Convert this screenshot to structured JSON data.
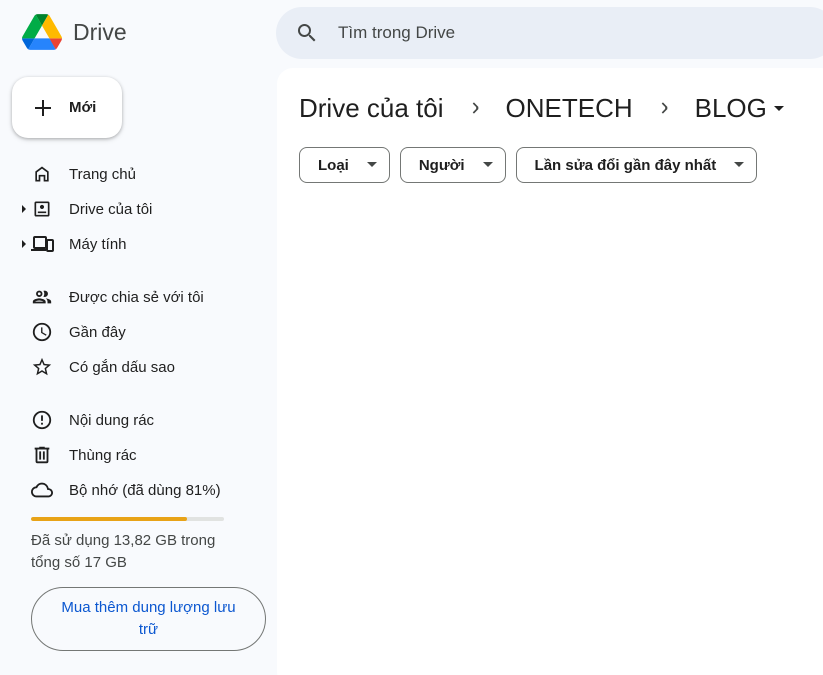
{
  "app": {
    "name": "Drive"
  },
  "search": {
    "placeholder": "Tìm trong Drive"
  },
  "new_button": {
    "label": "Mới"
  },
  "sidebar": {
    "items": [
      {
        "label": "Trang chủ",
        "icon": "home-icon"
      },
      {
        "label": "Drive của tôi",
        "icon": "my-drive-icon",
        "expandable": true
      },
      {
        "label": "Máy tính",
        "icon": "computers-icon",
        "expandable": true
      },
      {
        "label": "Được chia sẻ với tôi",
        "icon": "shared-icon"
      },
      {
        "label": "Gần đây",
        "icon": "clock-icon"
      },
      {
        "label": "Có gắn dấu sao",
        "icon": "star-icon"
      },
      {
        "label": "Nội dung rác",
        "icon": "spam-icon"
      },
      {
        "label": "Thùng rác",
        "icon": "trash-icon"
      },
      {
        "label": "Bộ nhớ (đã dùng 81%)",
        "icon": "cloud-icon"
      }
    ]
  },
  "storage": {
    "used_fraction": 0.81,
    "text": "Đã sử dụng 13,82 GB trong tổng số 17 GB",
    "buy_label": "Mua thêm dung lượng lưu trữ"
  },
  "breadcrumb": {
    "items": [
      "Drive của tôi",
      "ONETECH"
    ],
    "current": "BLOG"
  },
  "filters": {
    "type_label": "Loại",
    "people_label": "Người",
    "modified_label": "Lần sửa đổi gần đây nhất"
  },
  "colors": {
    "background": "#f8fafd",
    "search_bg": "#e9eef6",
    "storage_fill": "#e8a317",
    "link_blue": "#0b57d0"
  }
}
